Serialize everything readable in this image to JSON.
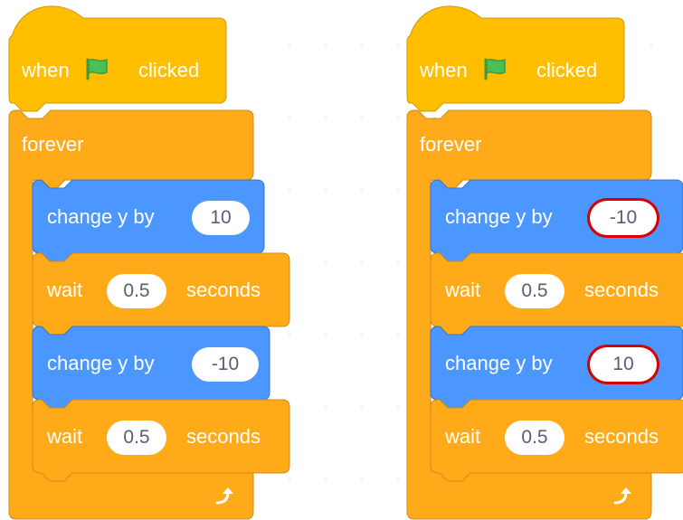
{
  "colors": {
    "events": "#FFBF00",
    "events_border": "#CC9900",
    "control": "#FFAB19",
    "control_border": "#CF8B17",
    "motion": "#4C97FF",
    "motion_border": "#3373CC",
    "flag": "#4CBF56",
    "highlight": "#D50000"
  },
  "icons": {
    "flag": "green-flag-icon",
    "loop": "loop-arrow-icon"
  },
  "scripts": [
    {
      "hat": {
        "when": "when",
        "clicked": "clicked"
      },
      "loop": {
        "label": "forever"
      },
      "blocks": [
        {
          "type": "change_y",
          "label": "change y by",
          "value": "10"
        },
        {
          "type": "wait",
          "label": "wait",
          "value": "0.5",
          "suffix": "seconds"
        },
        {
          "type": "change_y",
          "label": "change y by",
          "value": "-10"
        },
        {
          "type": "wait",
          "label": "wait",
          "value": "0.5",
          "suffix": "seconds"
        }
      ]
    },
    {
      "hat": {
        "when": "when",
        "clicked": "clicked"
      },
      "loop": {
        "label": "forever"
      },
      "blocks": [
        {
          "type": "change_y",
          "label": "change y by",
          "value": "-10",
          "highlighted": true
        },
        {
          "type": "wait",
          "label": "wait",
          "value": "0.5",
          "suffix": "seconds"
        },
        {
          "type": "change_y",
          "label": "change y by",
          "value": "10",
          "highlighted": true
        },
        {
          "type": "wait",
          "label": "wait",
          "value": "0.5",
          "suffix": "seconds"
        }
      ]
    }
  ]
}
